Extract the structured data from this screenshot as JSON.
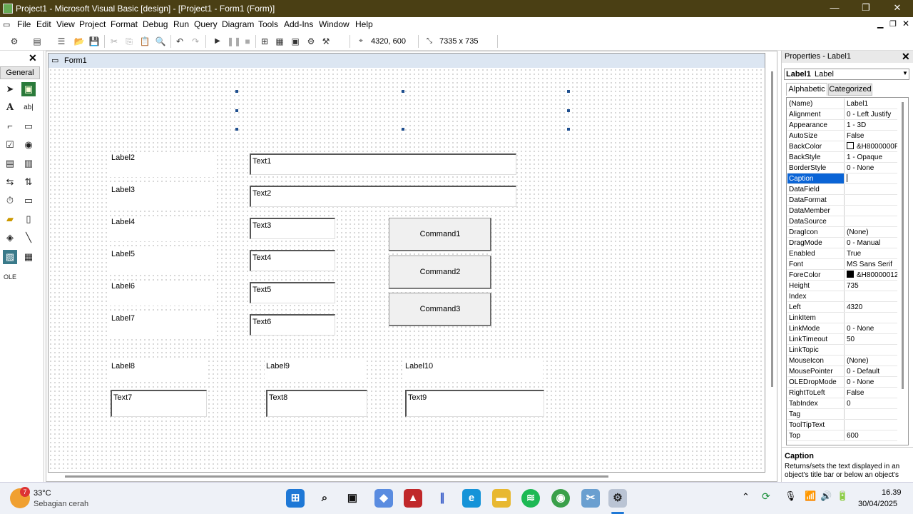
{
  "window": {
    "title": "Project1 - Microsoft Visual Basic [design] - [Project1 - Form1 (Form)]",
    "min": "—",
    "max": "❐",
    "close": "✕"
  },
  "menu": [
    "File",
    "Edit",
    "View",
    "Project",
    "Format",
    "Debug",
    "Run",
    "Query",
    "Diagram",
    "Tools",
    "Add-Ins",
    "Window",
    "Help"
  ],
  "toolbar": {
    "position": "4320, 600",
    "size": "7335 x 735"
  },
  "toolbox": {
    "close": "✕",
    "tab": "General"
  },
  "form": {
    "title": "Form1",
    "labels": [
      "Label2",
      "Label3",
      "Label4",
      "Label5",
      "Label6",
      "Label7",
      "Label8",
      "Label9",
      "Label10"
    ],
    "textboxes": [
      "Text1",
      "Text2",
      "Text3",
      "Text4",
      "Text5",
      "Text6",
      "Text7",
      "Text8",
      "Text9"
    ],
    "commands": [
      "Command1",
      "Command2",
      "Command3"
    ]
  },
  "properties": {
    "title": "Properties - Label1",
    "close": "✕",
    "object_name": "Label1",
    "object_type": "Label",
    "tabs": [
      "Alphabetic",
      "Categorized"
    ],
    "rows": [
      {
        "name": "(Name)",
        "value": "Label1"
      },
      {
        "name": "Alignment",
        "value": "0 - Left Justify"
      },
      {
        "name": "Appearance",
        "value": "1 - 3D"
      },
      {
        "name": "AutoSize",
        "value": "False"
      },
      {
        "name": "BackColor",
        "value": "&H8000000F"
      },
      {
        "name": "BackStyle",
        "value": "1 - Opaque"
      },
      {
        "name": "BorderStyle",
        "value": "0 - None"
      },
      {
        "name": "Caption",
        "value": ""
      },
      {
        "name": "DataField",
        "value": ""
      },
      {
        "name": "DataFormat",
        "value": ""
      },
      {
        "name": "DataMember",
        "value": ""
      },
      {
        "name": "DataSource",
        "value": ""
      },
      {
        "name": "DragIcon",
        "value": "(None)"
      },
      {
        "name": "DragMode",
        "value": "0 - Manual"
      },
      {
        "name": "Enabled",
        "value": "True"
      },
      {
        "name": "Font",
        "value": "MS Sans Serif"
      },
      {
        "name": "ForeColor",
        "value": "&H80000012"
      },
      {
        "name": "Height",
        "value": "735"
      },
      {
        "name": "Index",
        "value": ""
      },
      {
        "name": "Left",
        "value": "4320"
      },
      {
        "name": "LinkItem",
        "value": ""
      },
      {
        "name": "LinkMode",
        "value": "0 - None"
      },
      {
        "name": "LinkTimeout",
        "value": "50"
      },
      {
        "name": "LinkTopic",
        "value": ""
      },
      {
        "name": "MouseIcon",
        "value": "(None)"
      },
      {
        "name": "MousePointer",
        "value": "0 - Default"
      },
      {
        "name": "OLEDropMode",
        "value": "0 - None"
      },
      {
        "name": "RightToLeft",
        "value": "False"
      },
      {
        "name": "TabIndex",
        "value": "0"
      },
      {
        "name": "Tag",
        "value": ""
      },
      {
        "name": "ToolTipText",
        "value": ""
      },
      {
        "name": "Top",
        "value": "600"
      }
    ],
    "selected_property": "Caption",
    "backcolor_swatch": "#ffffff",
    "forecolor_swatch": "#000000",
    "desc_title": "Caption",
    "desc_text": "Returns/sets the text displayed in an object's title bar or below an object's"
  },
  "taskbar": {
    "weather_temp": "33°C",
    "weather_desc": "Sebagian cerah",
    "weather_badge": "7",
    "time": "16.39",
    "date": "30/04/2025"
  },
  "colors": {
    "title_bar": "#4a3f14",
    "selection": "#0a64d6",
    "form_title": "#dce6f2"
  }
}
